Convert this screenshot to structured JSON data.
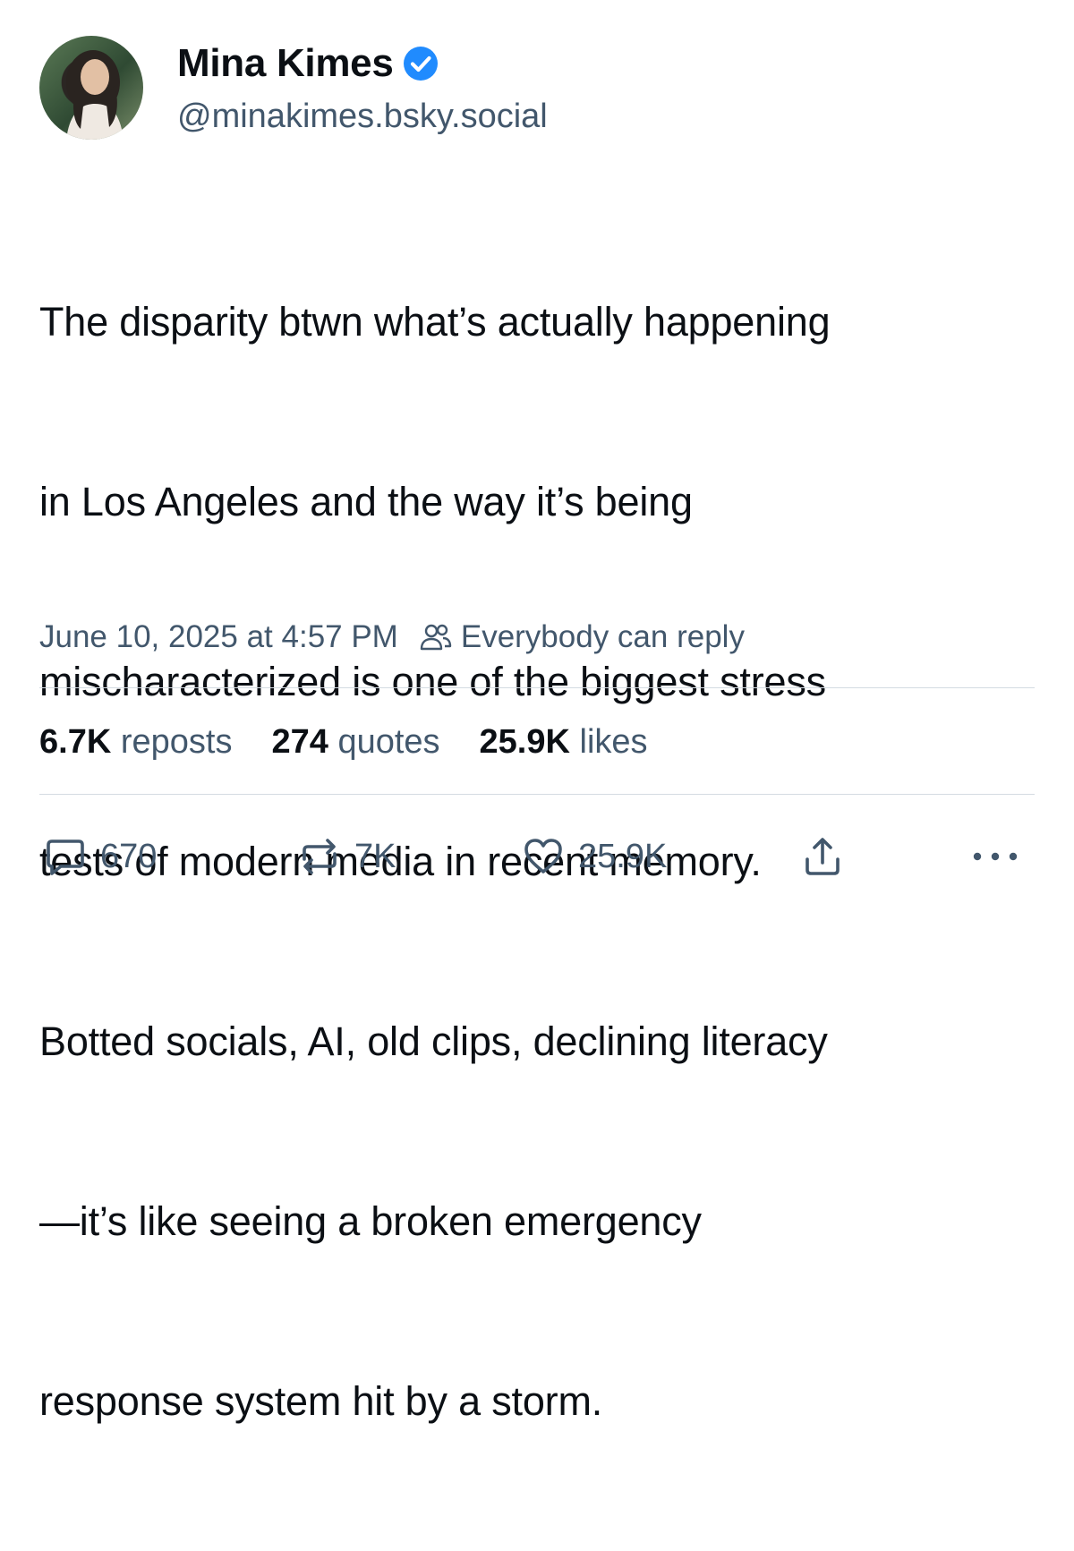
{
  "author": {
    "display_name": "Mina Kimes",
    "handle": "@minakimes.bsky.social",
    "verified": true,
    "verified_color": "#208bfe"
  },
  "post": {
    "lines": [
      "The disparity btwn what’s actually happening",
      "in Los Angeles and the way it’s being",
      "mischaracterized is one of the biggest stress",
      "tests of modern media in recent memory.",
      "Botted socials, AI, old clips, declining literacy",
      "—it’s like seeing a broken emergency",
      "response system hit by a storm."
    ],
    "timestamp": "June 10, 2025 at 4:57 PM",
    "reply_setting": "Everybody can reply"
  },
  "stats": {
    "reposts_count": "6.7K",
    "reposts_label": "reposts",
    "quotes_count": "274",
    "quotes_label": "quotes",
    "likes_count": "25.9K",
    "likes_label": "likes"
  },
  "actions": {
    "reply_count": "670",
    "repost_count": "7K",
    "like_count": "25.9K"
  },
  "icons": {
    "reply": "speech-bubble-icon",
    "repost": "repost-arrows-icon",
    "like": "heart-icon",
    "share": "share-icon",
    "more": "ellipsis-icon",
    "reply_setting": "people-icon",
    "verified": "verified-check-icon"
  },
  "colors": {
    "text": "#0b0f14",
    "secondary_text": "#42576c",
    "divider": "#d4dbe2"
  }
}
